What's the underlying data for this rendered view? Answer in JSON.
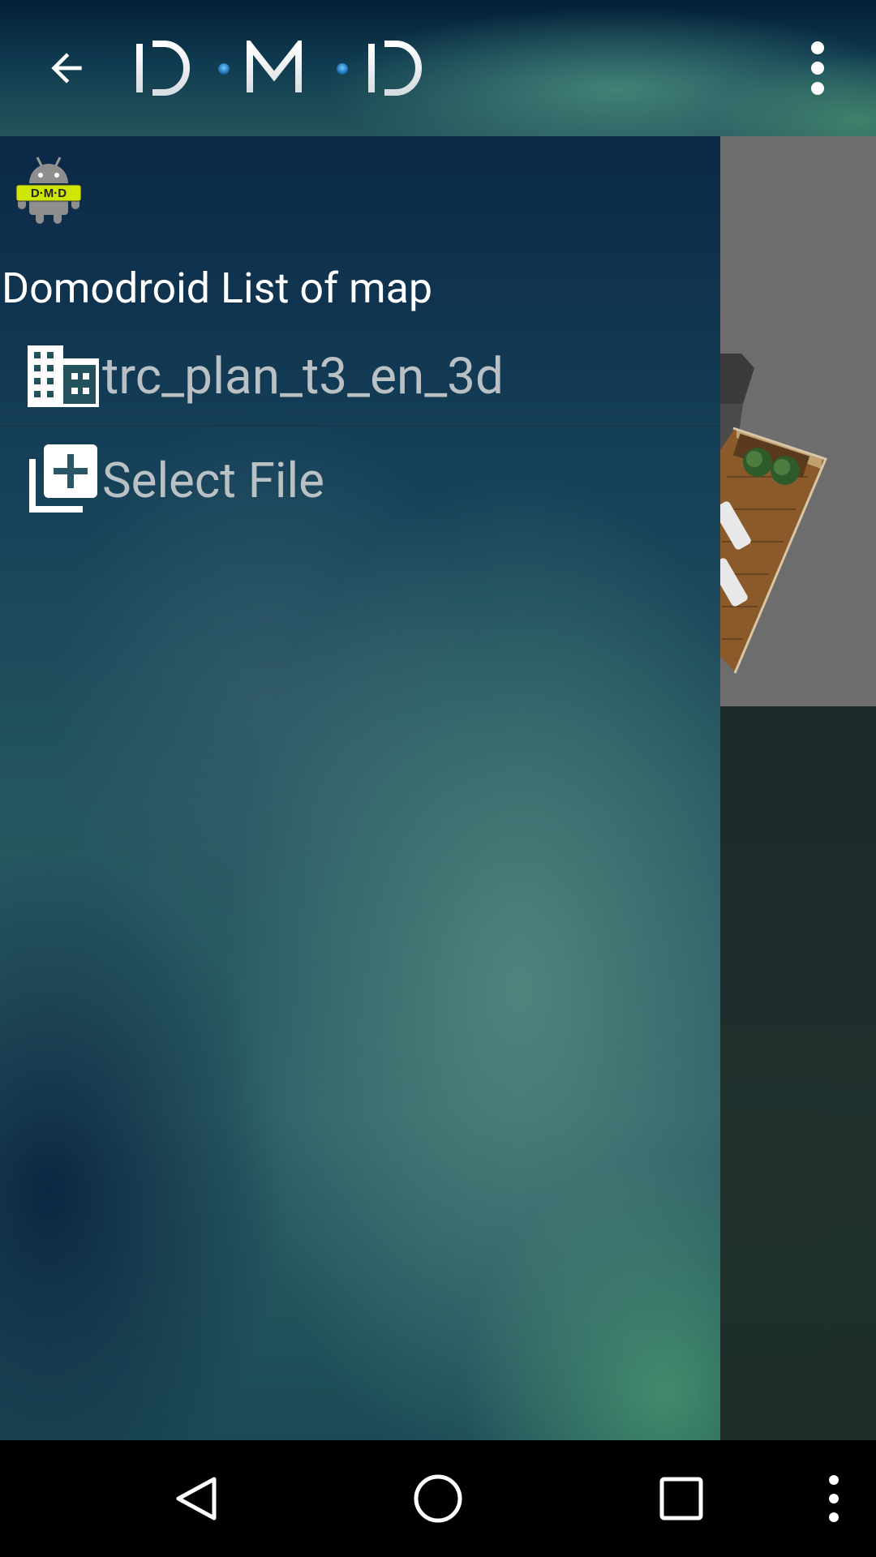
{
  "app_bar": {
    "logo_text": "D·M·D",
    "back_icon": "arrow-back-icon",
    "menu_icon": "more-vert-icon"
  },
  "drawer": {
    "app_icon": "android-dmd-icon",
    "title": "Domodroid List of map",
    "items": [
      {
        "label": "trc_plan_t3_en_3d",
        "icon": "building-icon"
      },
      {
        "label": "Select File",
        "icon": "add-to-library-icon"
      }
    ]
  },
  "nav_bar": {
    "back_icon": "nav-back-icon",
    "home_icon": "nav-home-icon",
    "recents_icon": "nav-recents-icon",
    "more_icon": "nav-more-icon"
  },
  "colors": {
    "app_bar_top": "#052038",
    "drawer_base": "#24545f",
    "title_text": "#ffffff",
    "item_text": "#b9c1c4",
    "map_background": "#6d6d6d",
    "nav_bar": "#000000"
  }
}
